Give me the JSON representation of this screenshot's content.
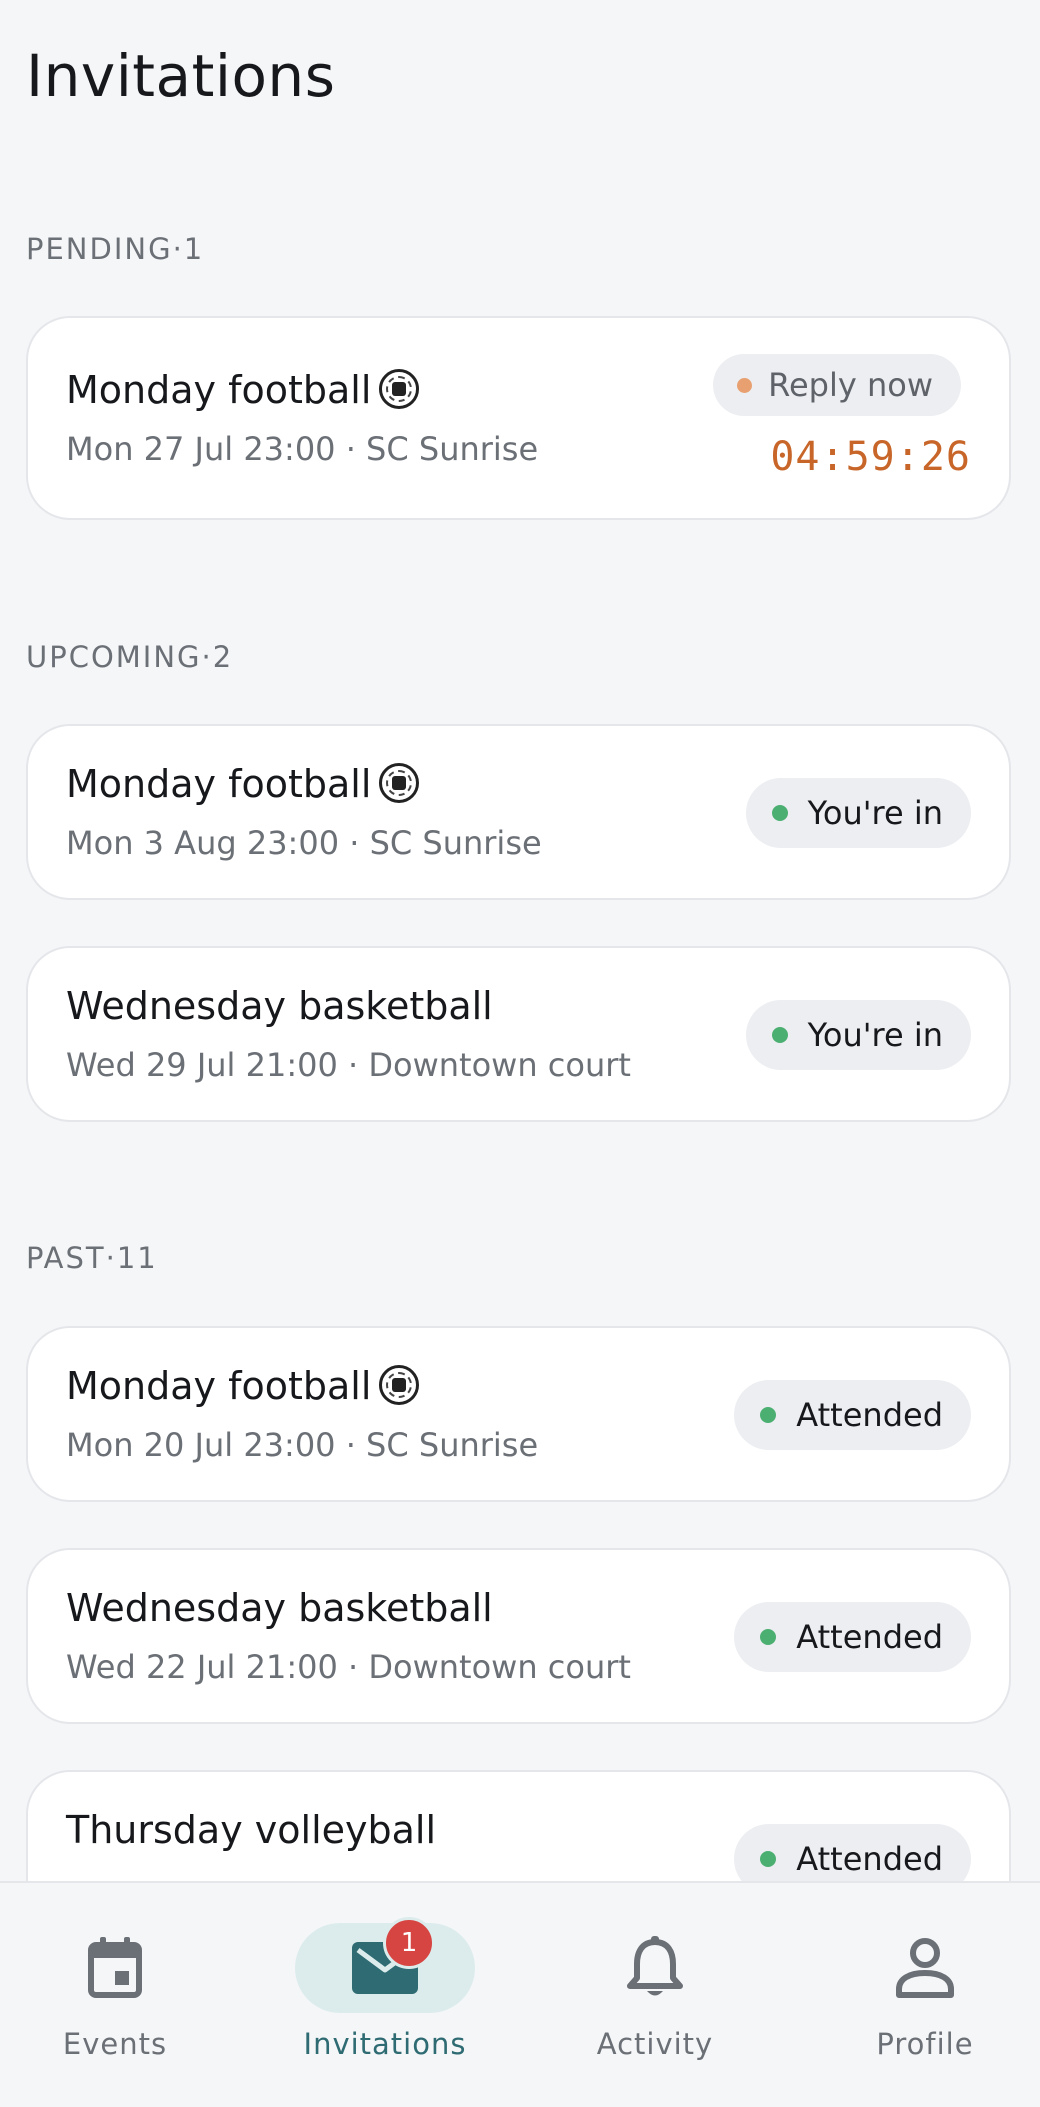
{
  "page": {
    "title": "Invitations"
  },
  "sections": {
    "pending": {
      "label": "PENDING",
      "count": "1"
    },
    "upcoming": {
      "label": "UPCOMING",
      "count": "2"
    },
    "past": {
      "label": "PAST",
      "count": "11"
    }
  },
  "separator": " · ",
  "pending_cards": [
    {
      "title": "Monday football",
      "subtitle": "Mon 27 Jul 23:00 · SC Sunrise",
      "status": "Reply now",
      "status_color": "#e8a070",
      "countdown": "04:59:26",
      "icon": "soccer-ball-icon"
    }
  ],
  "upcoming_cards": [
    {
      "title": "Monday football",
      "subtitle": "Mon 3 Aug 23:00 · SC Sunrise",
      "status": "You're in",
      "status_color": "#4caf72",
      "icon": "soccer-ball-icon"
    },
    {
      "title": "Wednesday basketball",
      "subtitle": "Wed 29 Jul 21:00 · Downtown court",
      "status": "You're in",
      "status_color": "#4caf72"
    }
  ],
  "past_cards": [
    {
      "title": "Monday football",
      "subtitle": "Mon 20 Jul 23:00 · SC Sunrise",
      "status": "Attended",
      "status_color": "#4caf72",
      "icon": "soccer-ball-icon"
    },
    {
      "title": "Wednesday basketball",
      "subtitle": "Wed 22 Jul 21:00 · Downtown court",
      "status": "Attended",
      "status_color": "#4caf72"
    },
    {
      "title": "Thursday volleyball",
      "subtitle": "",
      "status": "Attended",
      "status_color": "#4caf72"
    }
  ],
  "nav": {
    "items": [
      {
        "label": "Events",
        "icon": "calendar-icon"
      },
      {
        "label": "Invitations",
        "icon": "envelope-icon",
        "badge": "1",
        "active": true
      },
      {
        "label": "Activity",
        "icon": "bell-icon"
      },
      {
        "label": "Profile",
        "icon": "person-icon"
      }
    ]
  },
  "colors": {
    "accent": "#2e6b72",
    "badge": "#d64541",
    "countdown": "#c8662a"
  }
}
